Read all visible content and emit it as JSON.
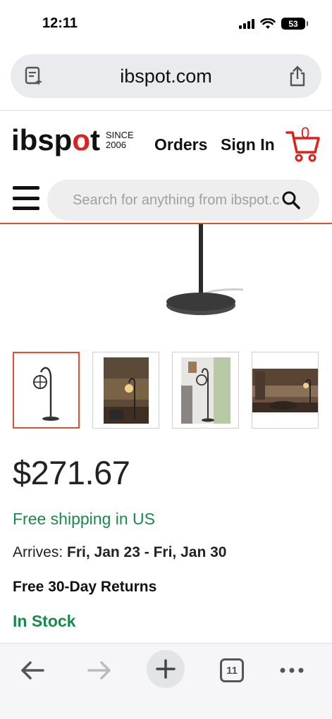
{
  "status_bar": {
    "time": "12:11",
    "battery": "53",
    "icons": [
      "cellular-signal-icon",
      "wifi-icon",
      "battery-icon"
    ]
  },
  "browser": {
    "url": "ibspot.com",
    "left_icon": "page-menu-icon",
    "right_icon": "share-icon"
  },
  "header": {
    "logo_text": "ibsp",
    "logo_text_o": "o",
    "logo_text_end": "t",
    "since_line1": "SINCE",
    "since_line2": "2006",
    "orders_label": "Orders",
    "signin_label": "Sign In",
    "cart_count": "0"
  },
  "search": {
    "placeholder": "Search for anything from ibspot.c"
  },
  "product": {
    "thumbnails": [
      {
        "alt": "Lamp on white background",
        "active": true
      },
      {
        "alt": "Lamp in dark room",
        "active": false
      },
      {
        "alt": "Lamp by window",
        "active": false
      },
      {
        "alt": "Lamp in living room",
        "active": false
      }
    ],
    "price": "$271.67",
    "shipping": "Free shipping in US",
    "arrives_label": "Arrives:",
    "arrives_value": "Fri, Jan 23 - Fri, Jan 30",
    "returns": "Free 30-Day Returns",
    "stock": "In Stock"
  },
  "toolbar": {
    "tab_count": "11",
    "icons": [
      "back-arrow-icon",
      "forward-arrow-icon",
      "new-tab-plus-icon",
      "tabs-icon",
      "more-icon"
    ]
  },
  "colors": {
    "brand_red": "#e0201f",
    "green": "#1a8a4a",
    "accent_line": "#e0502f"
  }
}
